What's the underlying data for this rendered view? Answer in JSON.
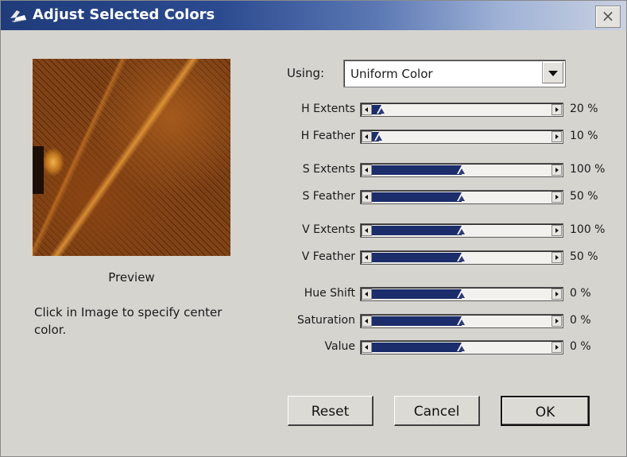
{
  "window": {
    "title": "Adjust Selected Colors",
    "close_label": "×"
  },
  "preview": {
    "label": "Preview",
    "hint": "Click in Image to specify center color."
  },
  "using": {
    "label": "Using:",
    "value": "Uniform Color"
  },
  "sliders": [
    {
      "label": "H Extents",
      "value": "20 %",
      "level": 20
    },
    {
      "label": "H Feather",
      "value": "10 %",
      "level": 10
    },
    {
      "label": "S Extents",
      "value": "100 %",
      "level": 100
    },
    {
      "label": "S Feather",
      "value": "50 %",
      "level": 50
    },
    {
      "label": "V Extents",
      "value": "100 %",
      "level": 100
    },
    {
      "label": "V Feather",
      "value": "50 %",
      "level": 50
    },
    {
      "label": "Hue Shift",
      "value": "0 %",
      "level": 0
    },
    {
      "label": "Saturation",
      "value": "0 %",
      "level": 0
    },
    {
      "label": "Value",
      "value": "0 %",
      "level": 0
    }
  ],
  "buttons": {
    "reset": "Reset",
    "cancel": "Cancel",
    "ok": "OK"
  },
  "colors": {
    "accent": "#1c2d6b",
    "title_bar": "#1f3b7a",
    "background": "#d6d4cf"
  }
}
